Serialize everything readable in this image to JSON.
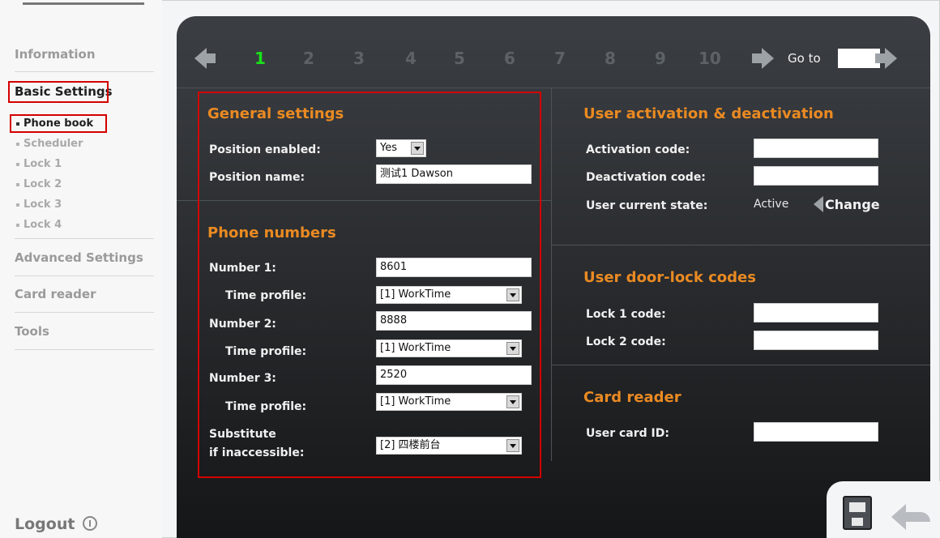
{
  "sidebar": {
    "information": "Information",
    "basic_settings": "Basic Settings",
    "sub_items": [
      "Phone book",
      "Scheduler",
      "Lock 1",
      "Lock 2",
      "Lock 3",
      "Lock 4"
    ],
    "advanced_settings": "Advanced Settings",
    "card_reader": "Card reader",
    "tools": "Tools",
    "logout": "Logout"
  },
  "pager": {
    "pages": [
      "1",
      "2",
      "3",
      "4",
      "5",
      "6",
      "7",
      "8",
      "9",
      "10"
    ],
    "current_page": "1",
    "goto_label": "Go to",
    "goto_value": ""
  },
  "general": {
    "title": "General settings",
    "position_enabled_label": "Position enabled:",
    "position_enabled_value": "Yes",
    "position_name_label": "Position name:",
    "position_name_value": "测试1 Dawson"
  },
  "phone": {
    "title": "Phone numbers",
    "number1_label": "Number 1:",
    "number1_value": "8601",
    "time_profile1_label": "Time profile:",
    "time_profile1_value": "[1] WorkTime",
    "number2_label": "Number 2:",
    "number2_value": "8888",
    "time_profile2_label": "Time profile:",
    "time_profile2_value": "[1] WorkTime",
    "number3_label": "Number 3:",
    "number3_value": "2520",
    "time_profile3_label": "Time profile:",
    "time_profile3_value": "[1] WorkTime",
    "substitute_label_1": "Substitute",
    "substitute_label_2": "if inaccessible:",
    "substitute_value": "[2] 四楼前台"
  },
  "activation": {
    "title": "User activation & deactivation",
    "activation_label": "Activation code:",
    "activation_value": "",
    "deactivation_label": "Deactivation code:",
    "deactivation_value": "",
    "state_label": "User current state:",
    "state_value": "Active",
    "change_label": "Change"
  },
  "doorlock": {
    "title": "User door-lock codes",
    "lock1_label": "Lock 1 code:",
    "lock1_value": "",
    "lock2_label": "Lock 2 code:",
    "lock2_value": ""
  },
  "cardreader": {
    "title": "Card reader",
    "card_label": "User card ID:",
    "card_value": ""
  },
  "colors": {
    "accent_orange": "#ea8a22",
    "current_page_green": "#19e219",
    "highlight_red": "#d40000"
  }
}
